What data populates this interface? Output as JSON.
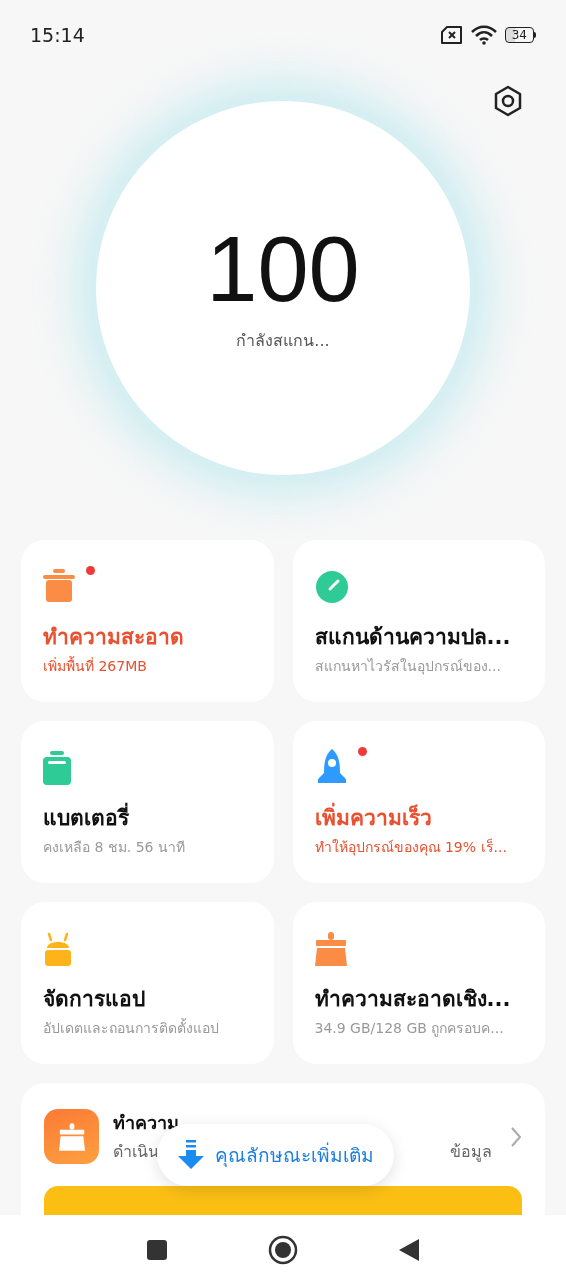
{
  "status_bar": {
    "time": "15:14",
    "battery": "34"
  },
  "scan": {
    "score": "100",
    "status": "กำลังสแกน..."
  },
  "cards": [
    {
      "kind": "trash",
      "title": "ทำความสะอาด",
      "subtitle": "เพิ่มพื้นที่ 267MB",
      "alert": true,
      "badge": true
    },
    {
      "kind": "gauge",
      "title": "สแกนด้านความปล...",
      "subtitle": "สแกนหาไวรัสในอุปกรณ์ของ...",
      "alert": false,
      "badge": false
    },
    {
      "kind": "battery",
      "title": "แบตเตอรี่",
      "subtitle": "คงเหลือ 8 ชม. 56 นาที",
      "alert": false,
      "badge": false
    },
    {
      "kind": "rocket",
      "title": "เพิ่มความเร็ว",
      "subtitle": "ทำให้อุปกรณ์ของคุณ 19% เร็...",
      "alert": true,
      "badge": true
    },
    {
      "kind": "android",
      "title": "จัดการแอป",
      "subtitle": "อัปเดตและถอนการติดตั้งแอป",
      "alert": false,
      "badge": false
    },
    {
      "kind": "brush",
      "title": "ทำความสะอาดเชิง...",
      "subtitle": "34.9 GB/128 GB ถูกครอบค...",
      "alert": false,
      "badge": false
    }
  ],
  "deep_clean": {
    "title": "ทำความ",
    "subtitle_start": "ดำเนิน",
    "subtitle_end": "ข้อมูล"
  },
  "more_features": {
    "label": "คุณลักษณะเพิ่มเติม"
  }
}
